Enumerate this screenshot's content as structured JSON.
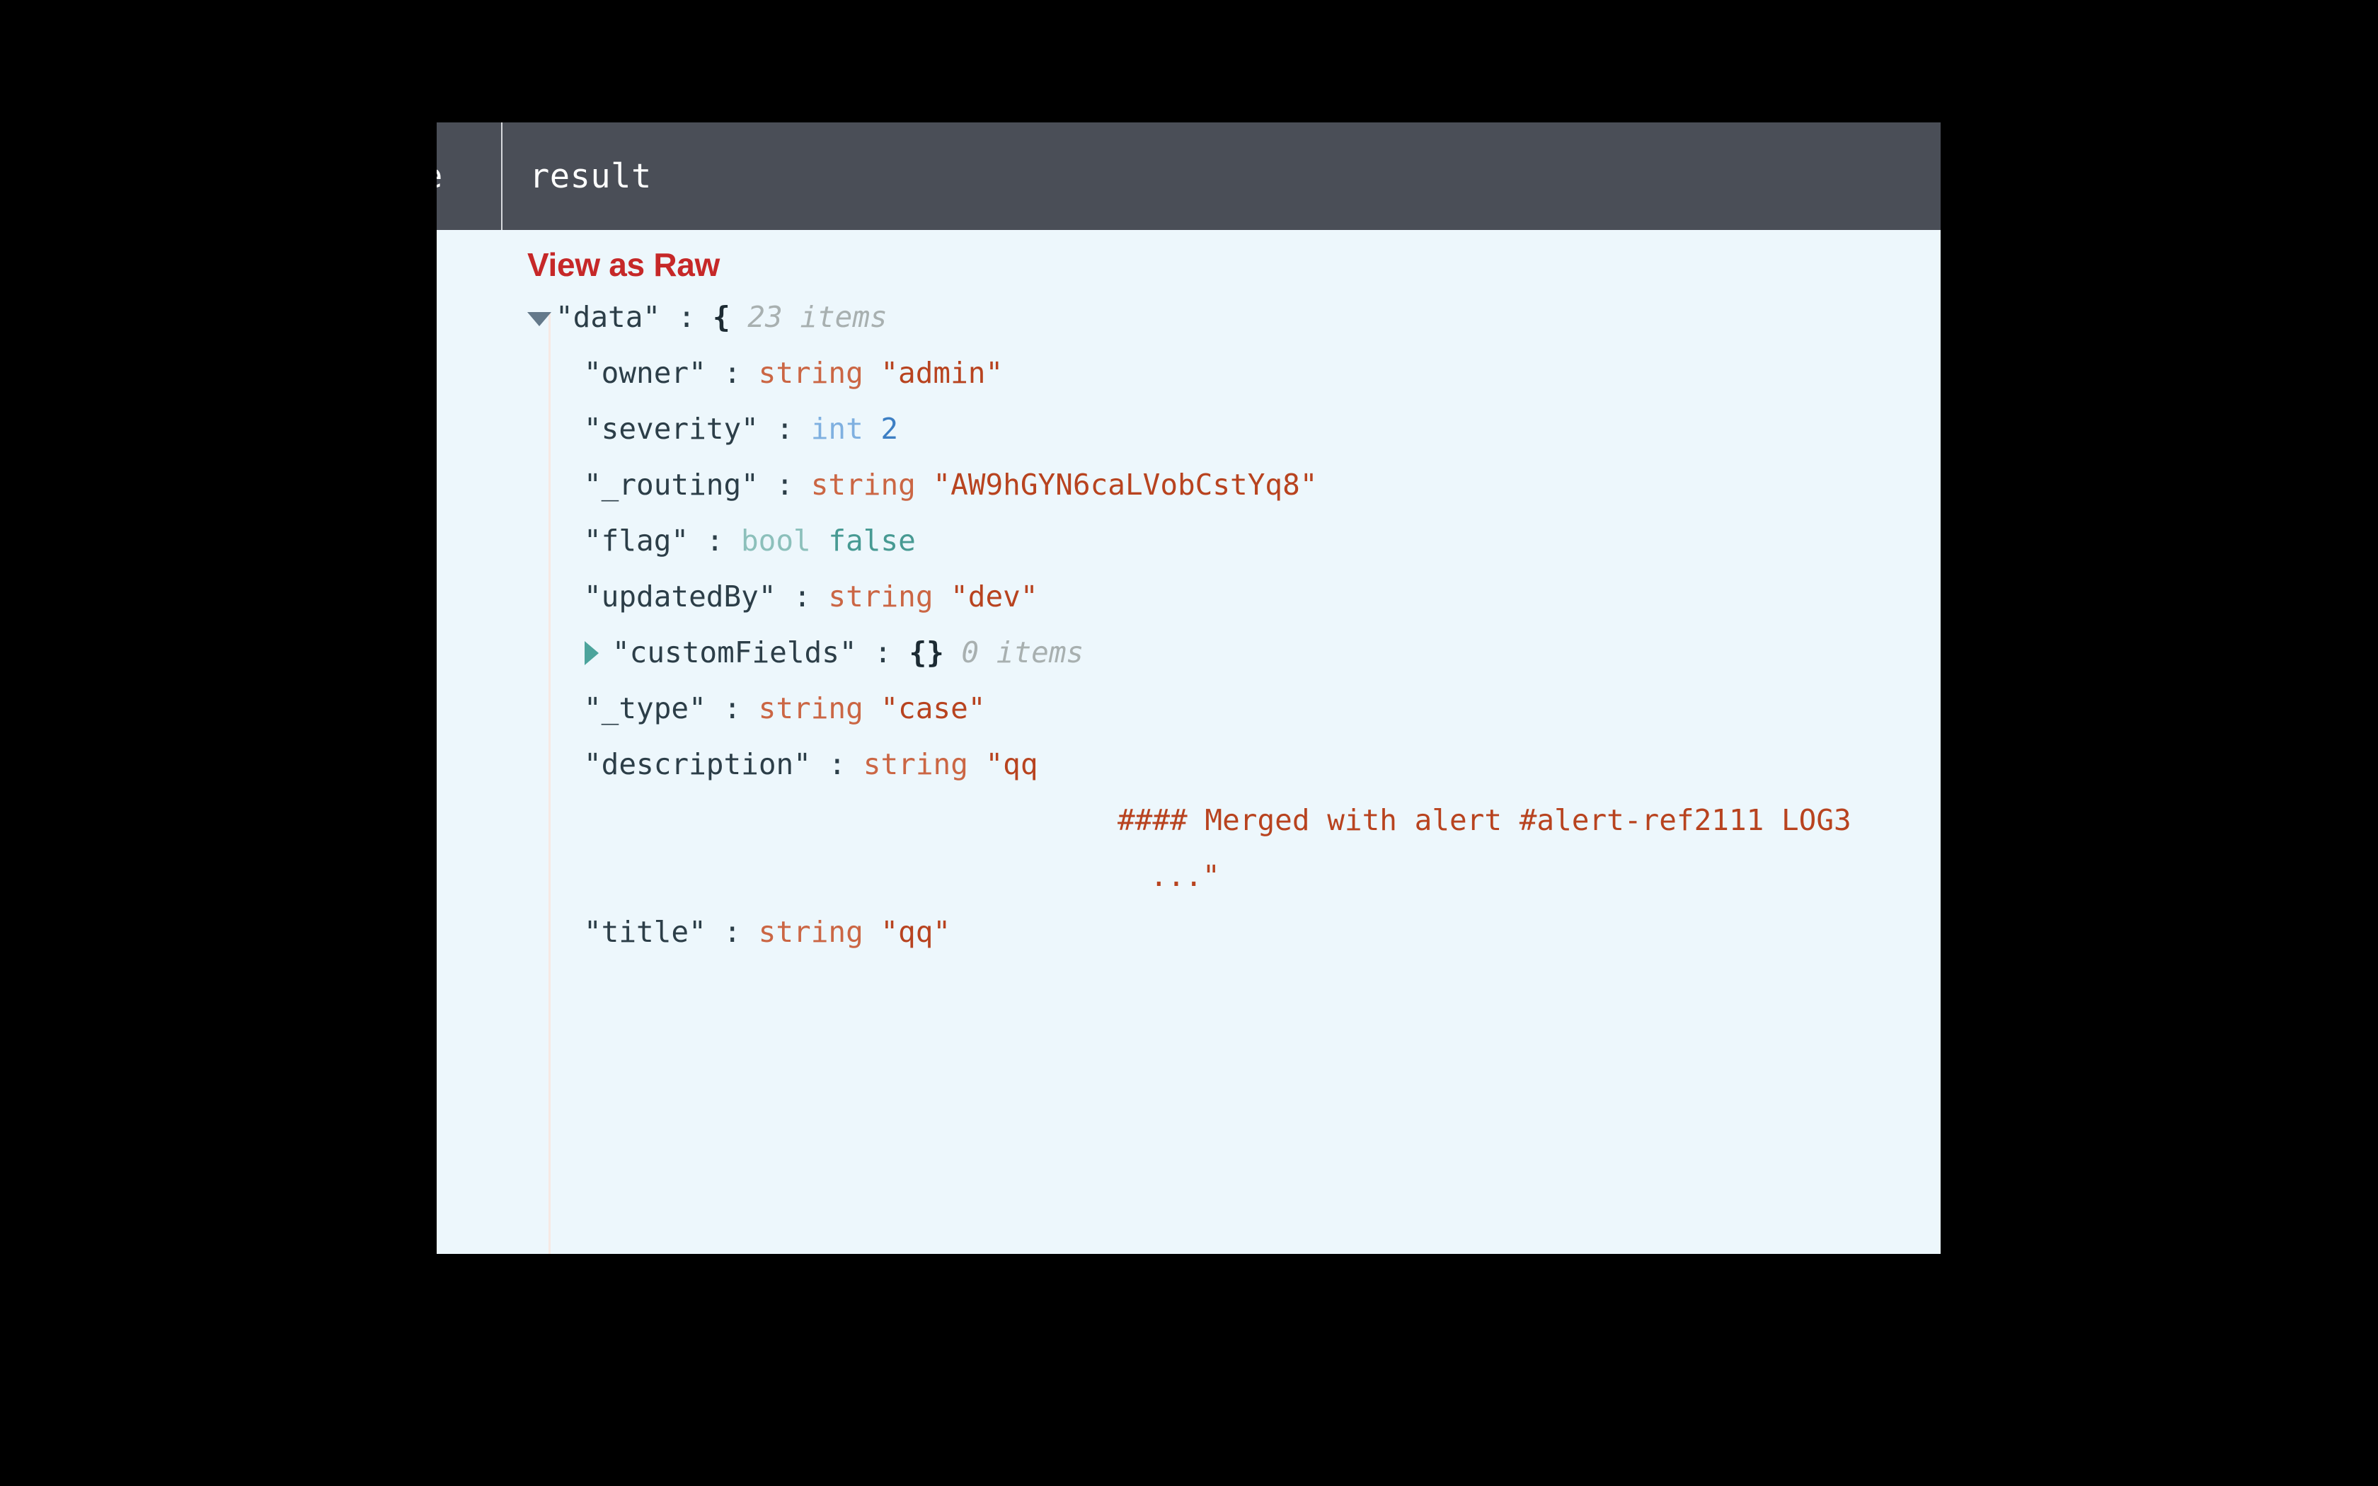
{
  "window": {
    "background_color": "#000000",
    "panel_background": "#edf7fc"
  },
  "header": {
    "background_color": "#4a4e57",
    "tabs": [
      {
        "label": "e",
        "truncated": true,
        "active": false
      },
      {
        "label": "result",
        "truncated": false,
        "active": true
      }
    ]
  },
  "toolbar": {
    "view_as_raw_label": "View as Raw",
    "accent_color": "#c62828"
  },
  "json_viewer": {
    "root": {
      "caret": "caret-down-icon",
      "key": "\"data\"",
      "colon": ":",
      "brace": "{",
      "count": "23 items"
    },
    "rows": [
      {
        "key": "\"owner\"",
        "colon": ":",
        "type": "string",
        "value": "\"admin\""
      },
      {
        "key": "\"severity\"",
        "colon": ":",
        "type": "int",
        "value": "2"
      },
      {
        "key": "\"_routing\"",
        "colon": ":",
        "type": "string",
        "value": "\"AW9hGYN6caLVobCstYq8\""
      },
      {
        "key": "\"flag\"",
        "colon": ":",
        "type": "bool",
        "value": "false"
      },
      {
        "key": "\"updatedBy\"",
        "colon": ":",
        "type": "string",
        "value": "\"dev\""
      },
      {
        "caret": "caret-right-icon",
        "key": "\"customFields\"",
        "colon": ":",
        "brace": "{}",
        "count": "0 items"
      },
      {
        "key": "\"_type\"",
        "colon": ":",
        "type": "string",
        "value": "\"case\""
      },
      {
        "key": "\"description\"",
        "colon": ":",
        "type": "string",
        "value": "\"qq"
      },
      {
        "continuation": "#### Merged with alert #alert-ref2111 LOG3"
      },
      {
        "continuation": "...\""
      },
      {
        "key": "\"title\"",
        "colon": ":",
        "type": "string",
        "value": "\"qq\""
      }
    ]
  },
  "colors": {
    "key": "#2c3e48",
    "string_type": "#cb6644",
    "string_value": "#b8431f",
    "int_type": "#7fb0e0",
    "int_value": "#3d7fc4",
    "bool_type": "#8cc0bb",
    "bool_value": "#479a93",
    "count_grey": "#a8b0b0",
    "caret_down": "#64798a",
    "caret_right": "#4ca49c"
  }
}
